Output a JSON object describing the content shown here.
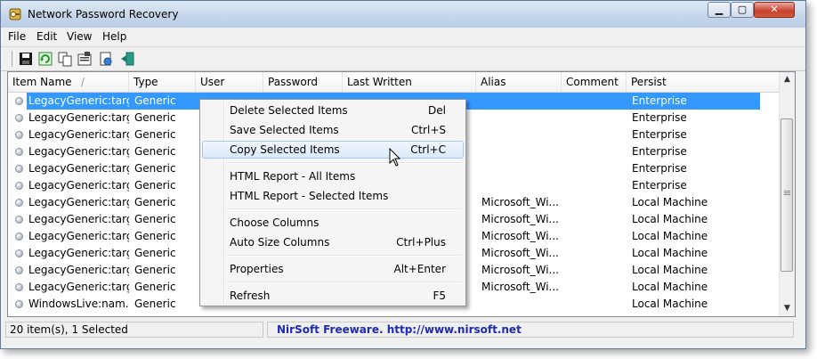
{
  "window": {
    "title": "Network Password Recovery"
  },
  "titlebar": {
    "min": "▁",
    "max": "▢",
    "close": "✕"
  },
  "menu": [
    "File",
    "Edit",
    "View",
    "Help"
  ],
  "toolbar": [
    "save-icon",
    "refresh-icon",
    "copy-icon",
    "properties-icon",
    "report-icon",
    "exit-icon"
  ],
  "columns": [
    "Item Name",
    "Type",
    "User",
    "Password",
    "Last Written",
    "Alias",
    "Comment",
    "Persist"
  ],
  "rows": [
    {
      "name": "LegacyGeneric:targ...",
      "type": "Generic",
      "alias": "",
      "persist": "Enterprise",
      "selected": true
    },
    {
      "name": "LegacyGeneric:targ...",
      "type": "Generic",
      "alias": "",
      "persist": "Enterprise"
    },
    {
      "name": "LegacyGeneric:targ...",
      "type": "Generic",
      "alias": "",
      "persist": "Enterprise"
    },
    {
      "name": "LegacyGeneric:targ...",
      "type": "Generic",
      "alias": "",
      "persist": "Enterprise"
    },
    {
      "name": "LegacyGeneric:targ...",
      "type": "Generic",
      "alias": "",
      "persist": "Enterprise"
    },
    {
      "name": "LegacyGeneric:targ...",
      "type": "Generic",
      "alias": "",
      "persist": "Enterprise"
    },
    {
      "name": "LegacyGeneric:targ...",
      "type": "Generic",
      "alias": "Microsoft_Wi...",
      "persist": "Local Machine"
    },
    {
      "name": "LegacyGeneric:targ...",
      "type": "Generic",
      "alias": "Microsoft_Wi...",
      "persist": "Local Machine"
    },
    {
      "name": "LegacyGeneric:targ...",
      "type": "Generic",
      "alias": "Microsoft_Wi...",
      "persist": "Local Machine"
    },
    {
      "name": "LegacyGeneric:targ...",
      "type": "Generic",
      "alias": "Microsoft_Wi...",
      "persist": "Local Machine"
    },
    {
      "name": "LegacyGeneric:targ...",
      "type": "Generic",
      "alias": "Microsoft_Wi...",
      "persist": "Local Machine"
    },
    {
      "name": "LegacyGeneric:targ...",
      "type": "Generic",
      "alias": "Microsoft_Wi...",
      "persist": "Local Machine"
    },
    {
      "name": "WindowsLive:nam...",
      "type": "Generic",
      "alias": "",
      "persist": "Local Machine"
    }
  ],
  "context_menu": {
    "items": [
      {
        "label": "Delete Selected Items",
        "shortcut": "Del"
      },
      {
        "label": "Save Selected Items",
        "shortcut": "Ctrl+S"
      },
      {
        "label": "Copy Selected Items",
        "shortcut": "Ctrl+C"
      },
      {
        "label": "HTML Report - All Items",
        "shortcut": ""
      },
      {
        "label": "HTML Report - Selected Items",
        "shortcut": ""
      },
      {
        "label": "Choose Columns",
        "shortcut": ""
      },
      {
        "label": "Auto Size Columns",
        "shortcut": "Ctrl+Plus"
      },
      {
        "label": "Properties",
        "shortcut": "Alt+Enter"
      },
      {
        "label": "Refresh",
        "shortcut": "F5"
      }
    ]
  },
  "status": {
    "count": "20 item(s), 1 Selected",
    "credit": "NirSoft Freeware.  http://www.nirsoft.net"
  },
  "colors": {
    "selection": "#3399ff",
    "credit": "#1e2ab8"
  }
}
